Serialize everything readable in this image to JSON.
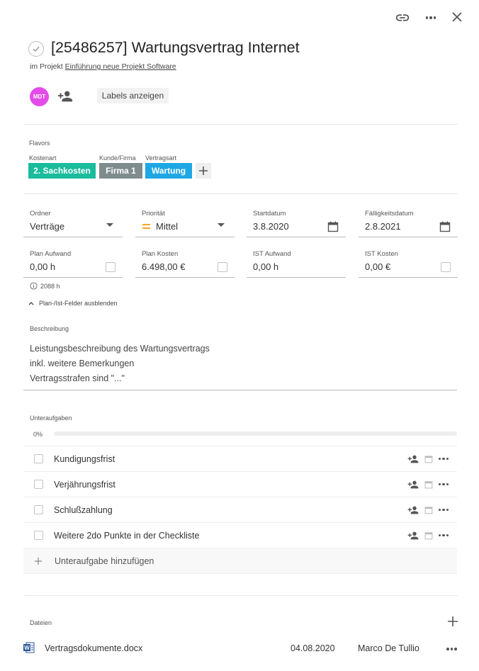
{
  "header": {
    "link_icon": "link-icon",
    "more_icon": "more-horizontal-icon",
    "close_icon": "close-icon"
  },
  "task": {
    "title": "[25486257] Wartungsvertrag Internet",
    "project_prefix": "im Projekt",
    "project_name": "Einführung neue Projekt Software"
  },
  "assignee": {
    "initials": "MDT",
    "avatar_color": "#e040fb"
  },
  "labels_button": "Labels anzeigen",
  "flavors": {
    "title": "Flavors",
    "groups": [
      {
        "label": "Kostenart",
        "chip": "2. Sachkosten",
        "color": "#1abc9c"
      },
      {
        "label": "Kunde/Firma",
        "chip": "Firma 1",
        "color": "#7f8c8d"
      },
      {
        "label": "Vertragsart",
        "chip": "Wartung",
        "color": "#1ea7e4"
      }
    ]
  },
  "fields": {
    "ordner": {
      "label": "Ordner",
      "value": "Verträge"
    },
    "prioritaet": {
      "label": "Priorität",
      "value": "Mittel",
      "color": "#f5a623"
    },
    "startdatum": {
      "label": "Startdatum",
      "value": "3.8.2020"
    },
    "faelligkeit": {
      "label": "Fälligkeitsdatum",
      "value": "2.8.2021"
    },
    "plan_aufwand": {
      "label": "Plan Aufwand",
      "value": "0,00 h"
    },
    "plan_kosten": {
      "label": "Plan Kosten",
      "value": "6.498,00 €"
    },
    "ist_aufwand": {
      "label": "IST Aufwand",
      "value": "0,00 h"
    },
    "ist_kosten": {
      "label": "IST Kosten",
      "value": "0,00 €"
    }
  },
  "hint": "2088 h",
  "toggle_fields": "Plan-/Ist-Felder ausblenden",
  "description": {
    "label": "Beschreibung",
    "lines": [
      "Leistungsbeschreibung des Wartungsvertrags",
      "inkl. weitere Bemerkungen",
      "Vertragsstrafen sind \"...\""
    ]
  },
  "subtasks": {
    "label": "Unteraufgaben",
    "progress_text": "0%",
    "progress": 0,
    "items": [
      "Kundigungsfrist",
      "Verjährungsfrist",
      "Schlußzahlung",
      "Weitere 2do Punkte in der Checkliste"
    ],
    "add_label": "Unteraufgabe hinzufügen"
  },
  "files": {
    "label": "Dateien",
    "items": [
      {
        "name": "Vertragsdokumente.docx",
        "date": "04.08.2020",
        "owner": "Marco De Tullio",
        "icon": "word-doc-icon"
      }
    ]
  }
}
